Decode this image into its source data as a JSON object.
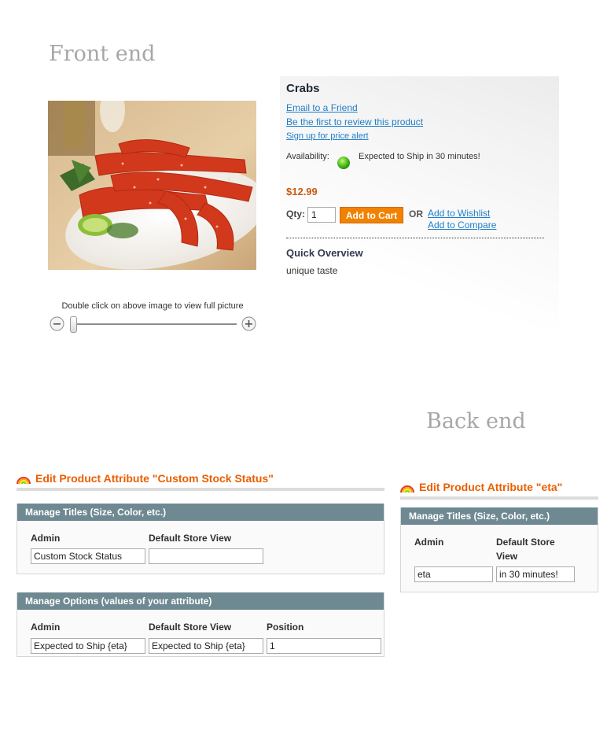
{
  "headings": {
    "front": "Front end",
    "back": "Back end"
  },
  "product": {
    "name": "Crabs",
    "email_link": "Email to a Friend",
    "review_link": "Be the first to review this product",
    "alert_link": "Sign up for price alert",
    "availability_label": "Availability:",
    "availability_text": "Expected to Ship in 30 minutes!",
    "price": "$12.99",
    "qty_label": "Qty:",
    "qty_value": "1",
    "add_to_cart": "Add to Cart",
    "or_label": "OR",
    "wishlist_link": "Add to Wishlist",
    "compare_link": "Add to Compare",
    "overview_title": "Quick Overview",
    "overview_text": "unique taste",
    "zoom_hint": "Double click on above image to view full picture",
    "zoom_level": 0
  },
  "attr_custom_stock": {
    "title": "Edit Product Attribute \"Custom Stock Status\"",
    "titles_section": {
      "header": "Manage Titles (Size, Color, etc.)",
      "col_admin": "Admin",
      "col_store": "Default Store View",
      "admin_value": "Custom Stock Status",
      "store_value": ""
    },
    "options_section": {
      "header": "Manage Options (values of your attribute)",
      "col_admin": "Admin",
      "col_store": "Default Store View",
      "col_position": "Position",
      "admin_value": "Expected to Ship {eta}",
      "store_value": "Expected to Ship {eta}",
      "position_value": "1"
    }
  },
  "attr_eta": {
    "title": "Edit Product Attribute \"eta\"",
    "titles_section": {
      "header": "Manage Titles (Size, Color, etc.)",
      "col_admin": "Admin",
      "col_store_line1": "Default Store",
      "col_store_line2": "View",
      "admin_value": "eta",
      "store_value": "in 30 minutes!"
    }
  },
  "colors": {
    "admin_accent": "#eb5e00",
    "grid_header": "#6f8992",
    "link": "#1e7ec8",
    "price": "#c75b12",
    "cart_button": "#f18200"
  },
  "icons": [
    "zoom-out-icon",
    "zoom-in-icon",
    "availability-dot-icon",
    "rainbow-icon"
  ]
}
